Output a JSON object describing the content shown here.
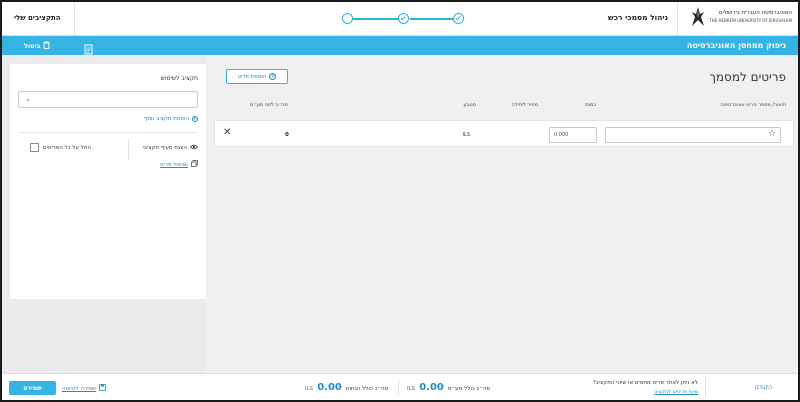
{
  "header": {
    "logo_hebrew": "האוניברסיטה העברית בירושלים",
    "logo_english": "THE HEBREW UNIVERSITY OF JERUSALEM",
    "page_title": "ניהול מסמכי רכש",
    "my_budgets": "התקציבים שלי",
    "steps_completed": 2,
    "steps_total": 3
  },
  "action_bar": {
    "title": "ניפוק ממחסן האוניברסיטה",
    "cancel_label": "ביטול"
  },
  "main": {
    "title": "פריטים למסמך",
    "add_item_label": "הוספת פריט",
    "columns": {
      "item": "תיאור/ מספר פריט אוניברסיטה",
      "quantity": "כמות",
      "unit_price": "מחיר ליחידה",
      "currency": "מטבע",
      "total": "סה״כ לפני מע״מ"
    },
    "rows": [
      {
        "item_value": "",
        "quantity": "0.000",
        "currency": "ILS",
        "total": "0"
      }
    ]
  },
  "budget_panel": {
    "label": "תקציב לשימוש",
    "add_budget": "הוספת תקציב נוסף",
    "show_budget_items": "הצגת סעיף תקציבי",
    "apply_to_all": "החל על כל הפריטים",
    "copy_item": "שכפול פריט"
  },
  "footer": {
    "next": "הקודם",
    "question": "לא ניתן לאתר פריט מתאים או שינוי התקציב?",
    "question_link": "שינוי פריטים לתקציב",
    "total_with_vat_label": "סה״כ כולל מע״מ",
    "total_with_vat_value": "0.00",
    "total_with_vat_currency": "ILS",
    "total_with_discounts_label": "סה״כ כולל הנחות",
    "total_with_discounts_value": "0.00",
    "total_with_discounts_currency": "ILS",
    "save_draft": "שמירה לטיוטה",
    "save": "שמירה"
  }
}
